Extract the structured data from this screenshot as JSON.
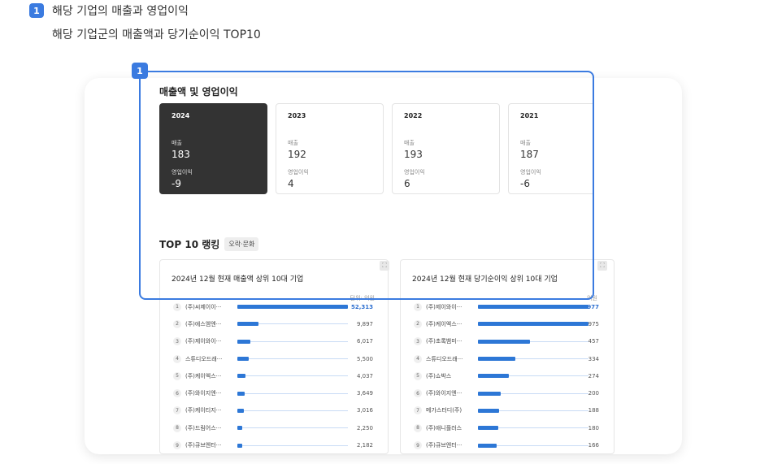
{
  "intro": {
    "badge": "1",
    "line1": "해당 기업의 매출과 영업이익",
    "line2": "해당 기업군의 매출액과 당기순이익 TOP10"
  },
  "highlight_badge": "1",
  "section_title": "매출액 및 영업이익",
  "years": [
    {
      "year": "2024",
      "sales_label": "매출",
      "sales": "183",
      "op_label": "영업이익",
      "op": "-9",
      "active": true
    },
    {
      "year": "2023",
      "sales_label": "매출",
      "sales": "192",
      "op_label": "영업이익",
      "op": "4",
      "active": false
    },
    {
      "year": "2022",
      "sales_label": "매출",
      "sales": "193",
      "op_label": "영업이익",
      "op": "6",
      "active": false
    },
    {
      "year": "2021",
      "sales_label": "매출",
      "sales": "187",
      "op_label": "영업이익",
      "op": "-6",
      "active": false
    }
  ],
  "top10": {
    "title": "TOP 10 랭킹",
    "category": "오락·문화"
  },
  "panels": [
    {
      "title": "2024년 12월 현재 매출액 상위 10대 기업",
      "unit": "단위: 억원",
      "max": 52313,
      "rows": [
        {
          "rank": "1",
          "name": "(주)씨제이이···",
          "value": "52,313",
          "num": 52313
        },
        {
          "rank": "2",
          "name": "(주)에스엠엔···",
          "value": "9,897",
          "num": 9897
        },
        {
          "rank": "3",
          "name": "(주)제이와이···",
          "value": "6,017",
          "num": 6017
        },
        {
          "rank": "4",
          "name": "스튜디오드래···",
          "value": "5,500",
          "num": 5500
        },
        {
          "rank": "5",
          "name": "(주)케이엑스···",
          "value": "4,037",
          "num": 4037
        },
        {
          "rank": "6",
          "name": "(주)와이지엔···",
          "value": "3,649",
          "num": 3649
        },
        {
          "rank": "7",
          "name": "(주)케이티지···",
          "value": "3,016",
          "num": 3016
        },
        {
          "rank": "8",
          "name": "(주)드림어스···",
          "value": "2,250",
          "num": 2250
        },
        {
          "rank": "9",
          "name": "(주)큐브엔터···",
          "value": "2,182",
          "num": 2182
        }
      ]
    },
    {
      "title": "2024년 12월 현재 당기순이익 상위 10대 기업",
      "unit": "억원",
      "max": 977,
      "rows": [
        {
          "rank": "1",
          "name": "(주)제이와이···",
          "value": "977",
          "num": 977
        },
        {
          "rank": "2",
          "name": "(주)케이엑스···",
          "value": "975",
          "num": 975
        },
        {
          "rank": "3",
          "name": "(주)초록뱀미···",
          "value": "457",
          "num": 457
        },
        {
          "rank": "4",
          "name": "스튜디오드래···",
          "value": "334",
          "num": 334
        },
        {
          "rank": "5",
          "name": "(주)쇼박스",
          "value": "274",
          "num": 274
        },
        {
          "rank": "6",
          "name": "(주)와이지엔···",
          "value": "200",
          "num": 200
        },
        {
          "rank": "7",
          "name": "메가스터디(주)",
          "value": "188",
          "num": 188
        },
        {
          "rank": "8",
          "name": "(주)애니플러스",
          "value": "180",
          "num": 180
        },
        {
          "rank": "9",
          "name": "(주)큐브엔터···",
          "value": "166",
          "num": 166
        }
      ]
    }
  ]
}
